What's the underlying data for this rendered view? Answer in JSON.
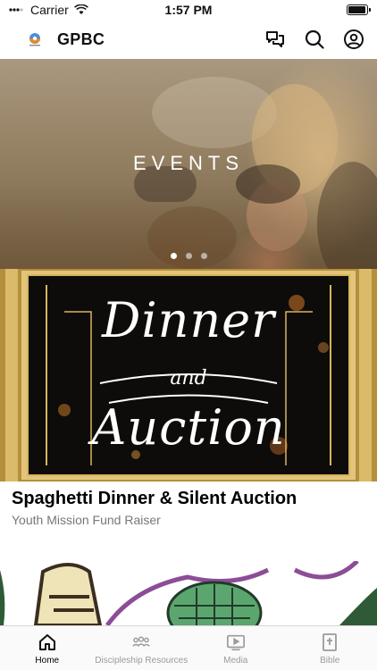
{
  "status_bar": {
    "carrier": "Carrier",
    "time": "1:57 PM",
    "battery_level": 0.95
  },
  "header": {
    "title": "GPBC",
    "icons": [
      "chat-icon",
      "search-icon",
      "account-icon"
    ]
  },
  "hero": {
    "title": "EVENTS",
    "slides_count": 3,
    "active_slide": 1
  },
  "event": {
    "artwork_text_1": "Dinner",
    "artwork_text_2": "and",
    "artwork_text_3": "Auction",
    "title": "Spaghetti Dinner & Silent Auction",
    "subtitle": "Youth Mission Fund Raiser"
  },
  "tabs": [
    {
      "label": "Home",
      "icon": "home-icon",
      "active": true
    },
    {
      "label": "Discipleship Resources",
      "icon": "group-icon",
      "active": false
    },
    {
      "label": "Media",
      "icon": "media-play-icon",
      "active": false
    },
    {
      "label": "Bible",
      "icon": "bible-icon",
      "active": false
    }
  ],
  "colors": {
    "accent": "#000000",
    "tab_inactive": "#9a9a9a",
    "frame_gold": "#d8b45c"
  }
}
